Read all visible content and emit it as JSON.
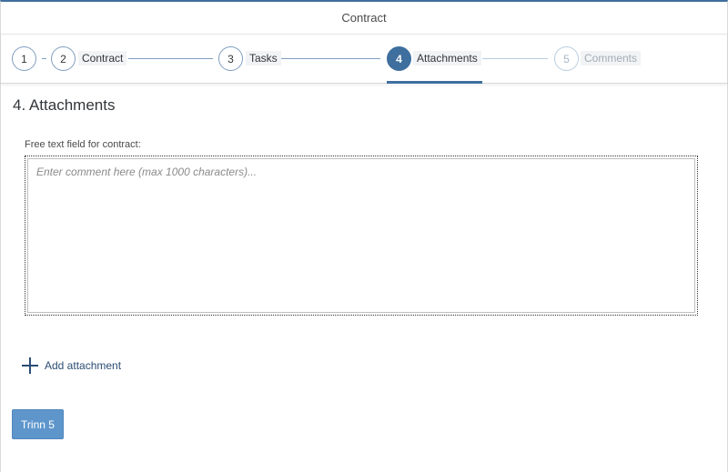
{
  "window": {
    "title": "Contract"
  },
  "wizard": {
    "steps": [
      {
        "number": "1",
        "label": ""
      },
      {
        "number": "2",
        "label": "Contract"
      },
      {
        "number": "3",
        "label": "Tasks"
      },
      {
        "number": "4",
        "label": "Attachments"
      },
      {
        "number": "5",
        "label": "Comments"
      }
    ],
    "active_step": 4
  },
  "section": {
    "title": "4. Attachments"
  },
  "comment_field": {
    "label": "Free text field for contract:",
    "value": "",
    "placeholder": "Enter comment here (max 1000 characters)..."
  },
  "add_attachment": {
    "label": "Add attachment",
    "icon": "plus-icon"
  },
  "next_button": {
    "label": "Trinn 5"
  },
  "colors": {
    "accent": "#3f6f9e",
    "button": "#5e96cc",
    "link": "#2b4d73"
  }
}
